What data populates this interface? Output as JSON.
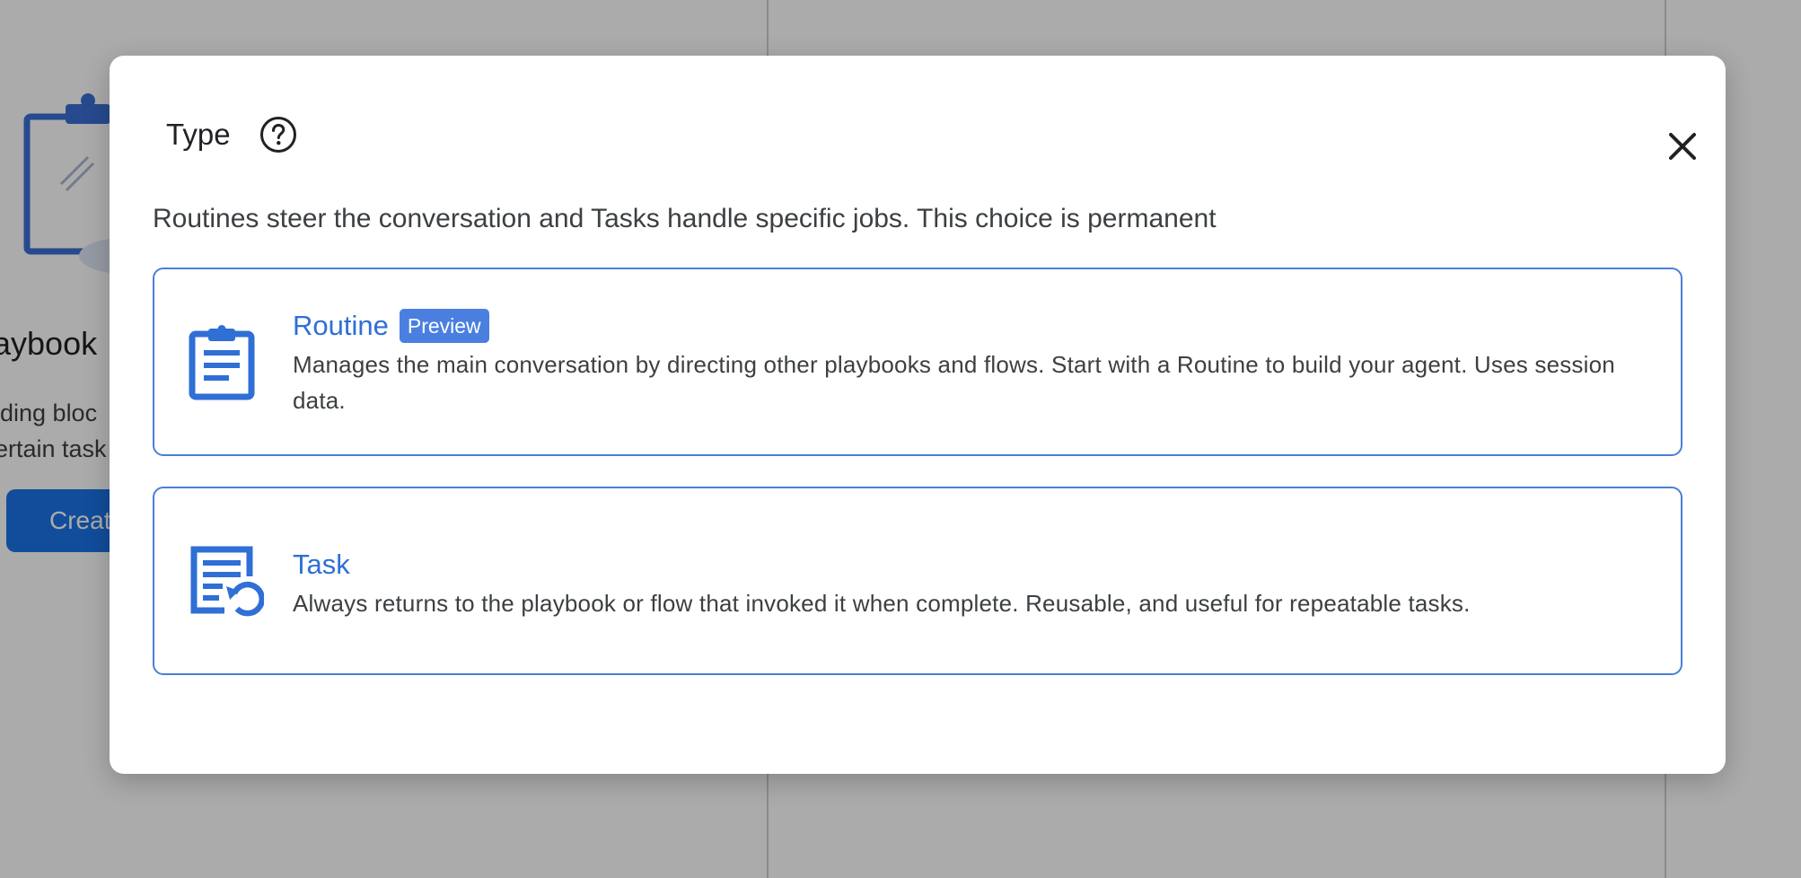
{
  "background": {
    "heading_fragment": "aybook",
    "desc_line1_fragment": "lding bloc",
    "desc_line2_fragment": "ertain task",
    "create_button_fragment": "Creat"
  },
  "dialog": {
    "title": "Type",
    "subtitle": "Routines steer the conversation and Tasks handle specific jobs. This choice is permanent",
    "options": [
      {
        "icon": "clipboard-icon",
        "title": "Routine",
        "badge": "Preview",
        "description": "Manages the main conversation by directing other playbooks and flows. Start with a Routine to build your agent. Uses session data."
      },
      {
        "icon": "task-return-icon",
        "title": "Task",
        "badge": "",
        "description": "Always returns to the playbook or flow that invoked it when complete. Reusable, and useful for repeatable tasks."
      }
    ]
  },
  "colors": {
    "accent": "#1a73e8",
    "card_border": "#4a7fd6",
    "badge": "#4a7fe0",
    "text": "#3c4043"
  }
}
